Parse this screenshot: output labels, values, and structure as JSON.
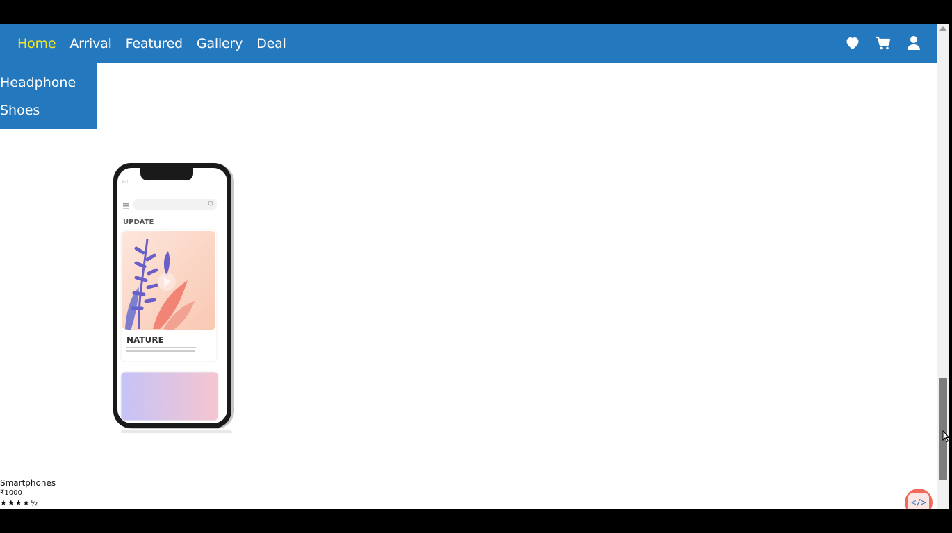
{
  "nav": {
    "links": [
      "Home",
      "Arrival",
      "Featured",
      "Gallery",
      "Deal"
    ],
    "active": "Home",
    "icons": [
      "heart-icon",
      "cart-icon",
      "user-icon"
    ]
  },
  "dropdown": {
    "items": [
      "Headphone",
      "Shoes"
    ]
  },
  "phone_screen": {
    "section_label": "UPDATE",
    "card_title": "NATURE"
  },
  "product": {
    "name": "Smartphones",
    "price": "₹1000",
    "rating": 4.5,
    "stars": "★★★★½"
  },
  "badge": {
    "label": "</>"
  },
  "colors": {
    "nav_bg": "#2478bd",
    "active_link": "#f4e523",
    "badge": "#f26a5a"
  }
}
